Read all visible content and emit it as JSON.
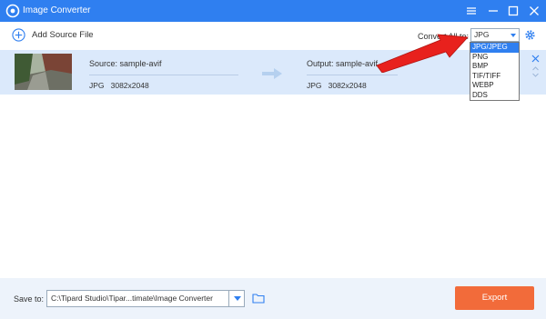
{
  "window": {
    "title": "Image Converter"
  },
  "toolbar": {
    "add_source_label": "Add Source File",
    "convert_all_label": "Convert All to:",
    "selected_format": "JPG"
  },
  "file": {
    "source_name": "Source: sample-avif",
    "source_format": "JPG",
    "source_resolution": "3082x2048",
    "output_name": "Output: sample-avif",
    "output_format": "JPG",
    "output_resolution": "3082x2048"
  },
  "format_options": [
    "JPG/JPEG",
    "PNG",
    "BMP",
    "TIF/TIFF",
    "WEBP",
    "DDS"
  ],
  "footer": {
    "save_to_label": "Save to:",
    "path": "C:\\Tipard Studio\\Tipar...timate\\Image Converter",
    "export_label": "Export"
  },
  "colors": {
    "accent": "#2f7ff0",
    "export": "#f26b3a",
    "row": "#dbe9fb",
    "annotation": "#e8211d"
  },
  "icons": [
    "app-logo-icon",
    "minimize-icon",
    "maximize-icon",
    "close-icon",
    "add-icon",
    "gear-icon",
    "arrow-right-icon",
    "remove-icon",
    "reorder-icon",
    "folder-icon",
    "caret-down-icon"
  ]
}
